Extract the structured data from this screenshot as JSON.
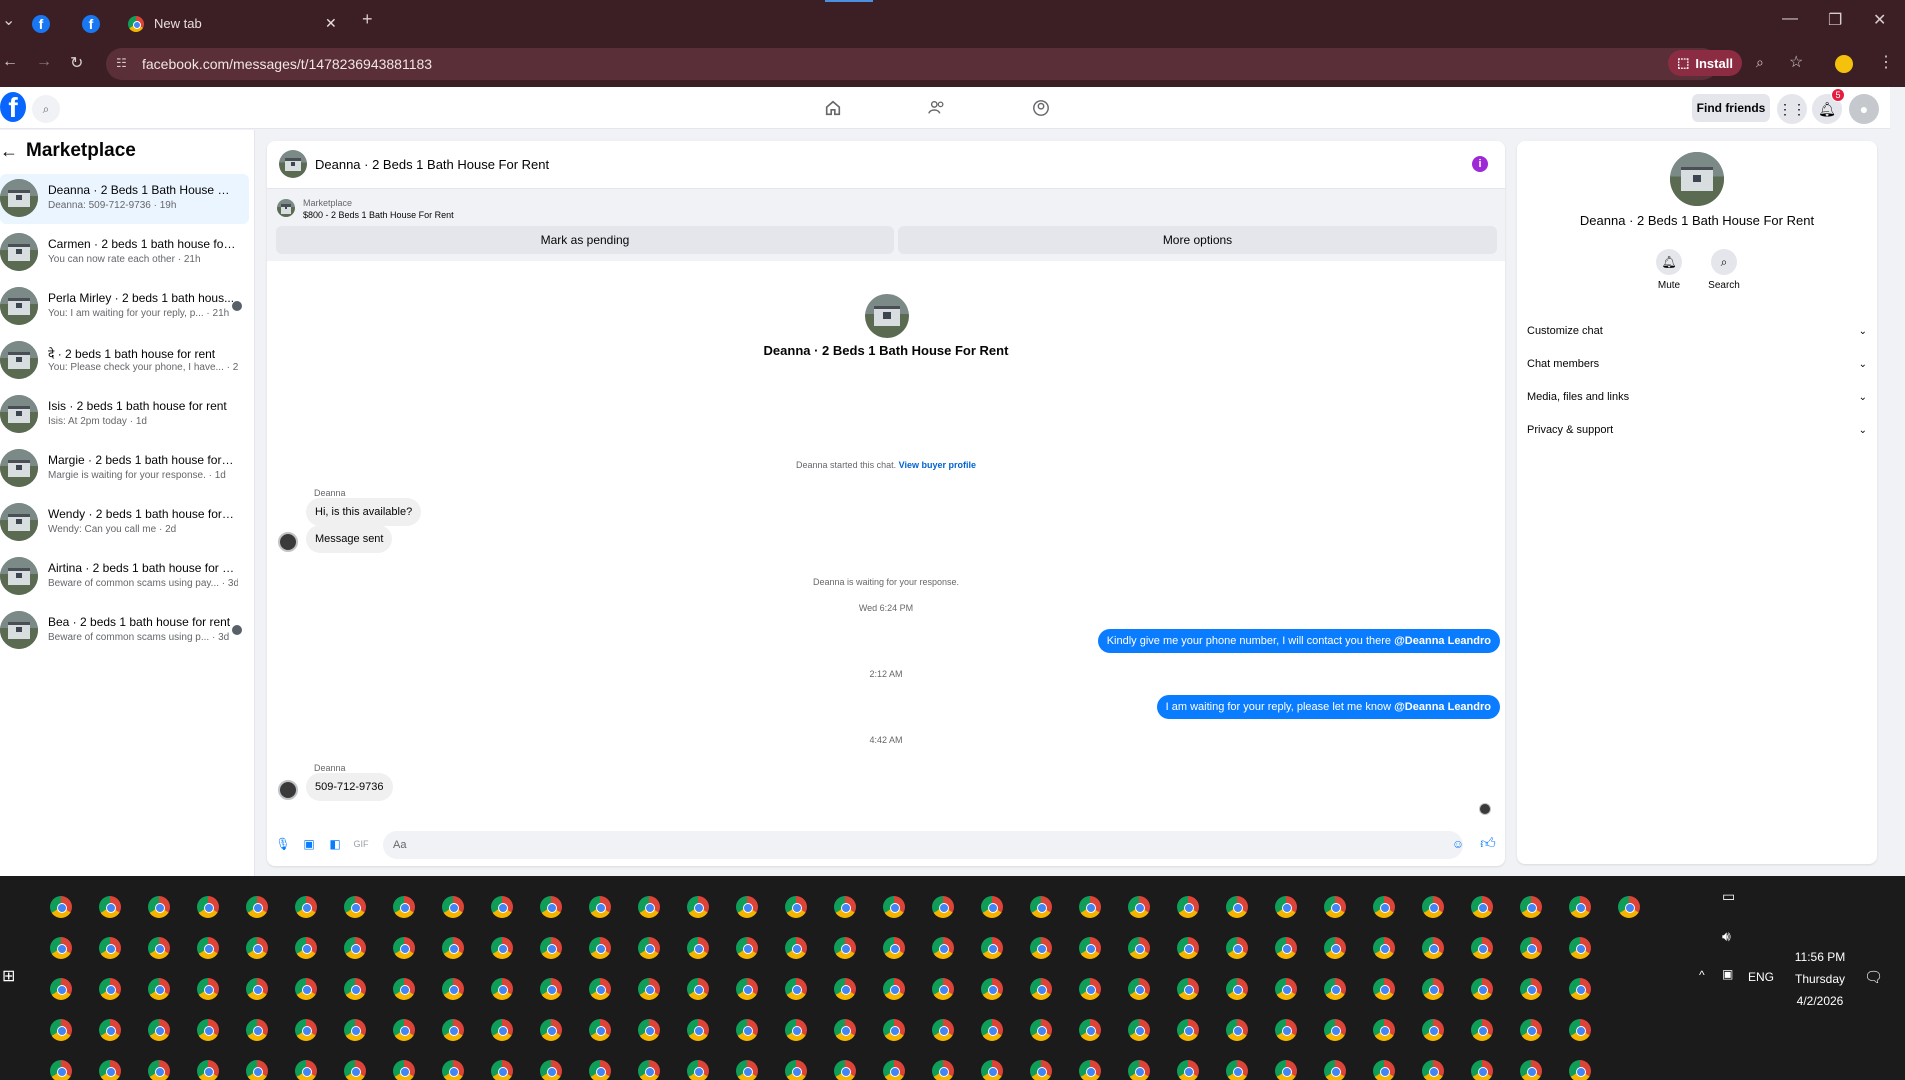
{
  "browser": {
    "tabs": [
      {
        "label": ""
      },
      {
        "label": ""
      },
      {
        "label": "New tab"
      }
    ],
    "url": "facebook.com/messages/t/1478236943881183",
    "install_label": "Install"
  },
  "fb": {
    "find_friends": "Find friends",
    "notification_count": "5"
  },
  "sidebar": {
    "title": "Marketplace",
    "conversations": [
      {
        "title": "Deanna · 2 Beds 1 Bath House For ...",
        "subtitle": "Deanna: 509-712-9736 · 19h"
      },
      {
        "title": "Carmen · 2 beds 1 bath house for r...",
        "subtitle": "You can now rate each other · 21h"
      },
      {
        "title": "Perla Mirley · 2 beds 1 bath hous...",
        "subtitle": "You: I am waiting for your reply, p... · 21h"
      },
      {
        "title": "दे · 2 beds 1 bath house for rent",
        "subtitle": "You: Please check your phone, I have... · 21h"
      },
      {
        "title": "Isis · 2 beds 1 bath house for rent",
        "subtitle": "Isis: At 2pm today · 1d"
      },
      {
        "title": "Margie · 2 beds 1 bath house for r...",
        "subtitle": "Margie is waiting for your response. · 1d"
      },
      {
        "title": "Wendy · 2 beds 1 bath house for re...",
        "subtitle": "Wendy: Can you call me · 2d"
      },
      {
        "title": "Airtina · 2 beds 1 bath house for re...",
        "subtitle": "Beware of common scams using pay... · 3d"
      },
      {
        "title": "Bea · 2 beds 1 bath house for rent",
        "subtitle": "Beware of common scams using p... · 3d"
      }
    ]
  },
  "chat": {
    "header_title": "Deanna · 2 Beds 1 Bath House For Rent",
    "marketplace_label": "Marketplace",
    "listing": "$800 - 2 Beds 1 Bath House For Rent",
    "mark_pending": "Mark as pending",
    "more_options": "More options",
    "center_name": "Deanna · 2 Beds 1 Bath House For Rent",
    "started_text": "Deanna started this chat.",
    "view_profile": "View buyer profile",
    "sender_name": "Deanna",
    "msg1": "Hi, is this available?",
    "msg2": "Message sent",
    "waiting_text": "Deanna is waiting for your response.",
    "time1": "Wed 6:24 PM",
    "out1_text": "Kindly give me your phone number, I will contact you there ",
    "out1_mention": "@Deanna Leandro",
    "time2": "2:12 AM",
    "out2_text": "I am waiting for your reply, please let me know ",
    "out2_mention": "@Deanna Leandro",
    "time3": "4:42 AM",
    "sender_name2": "Deanna",
    "msg3": "509-712-9736",
    "composer_placeholder": "Aa"
  },
  "right_panel": {
    "name": "Deanna · 2 Beds 1 Bath House For Rent",
    "mute_label": "Mute",
    "search_label": "Search",
    "rows": [
      {
        "label": "Customize chat"
      },
      {
        "label": "Chat members"
      },
      {
        "label": "Media, files and links"
      },
      {
        "label": "Privacy & support"
      }
    ]
  },
  "taskbar": {
    "time": "11:56 PM",
    "day": "Thursday",
    "date": "4/2/2026",
    "lang": "ENG"
  }
}
